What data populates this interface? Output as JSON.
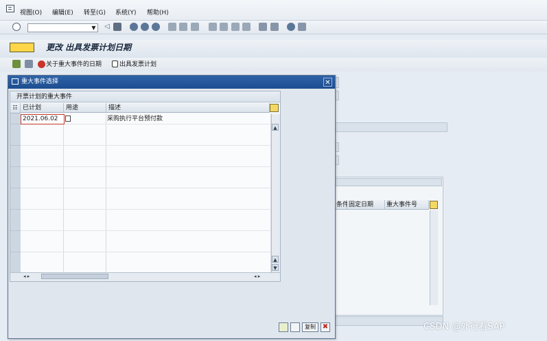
{
  "menu": {
    "items": [
      "视图(O)",
      "编辑(E)",
      "转至(G)",
      "系统(Y)",
      "帮助(H)"
    ]
  },
  "toolbar": {
    "command_field_value": ""
  },
  "screen": {
    "title": "更改 出具发票计划日期"
  },
  "app_toolbar": {
    "milestone_dates_label": "关于重大事件的日期",
    "billing_plan_label": "出具发票计划"
  },
  "dialog": {
    "title": "重大事件选择",
    "grid_caption": "开票计划的重大事件",
    "columns": [
      "已计划",
      "用途",
      "描述"
    ],
    "rows": [
      {
        "planned": "2021.06.02",
        "usage": "",
        "description": "采购执行平台预付款"
      }
    ],
    "copy_label": "复制",
    "cancel_symbol": "✖"
  },
  "background_grid": {
    "columns": [
      "条件",
      "固定日期",
      "重大事件号"
    ]
  },
  "watermark": "CSDN @外行看SAP",
  "colors": {
    "dialog_title": "#1d4d8f",
    "accent_yellow": "#ffd64a",
    "cancel_red": "#c0271d"
  }
}
